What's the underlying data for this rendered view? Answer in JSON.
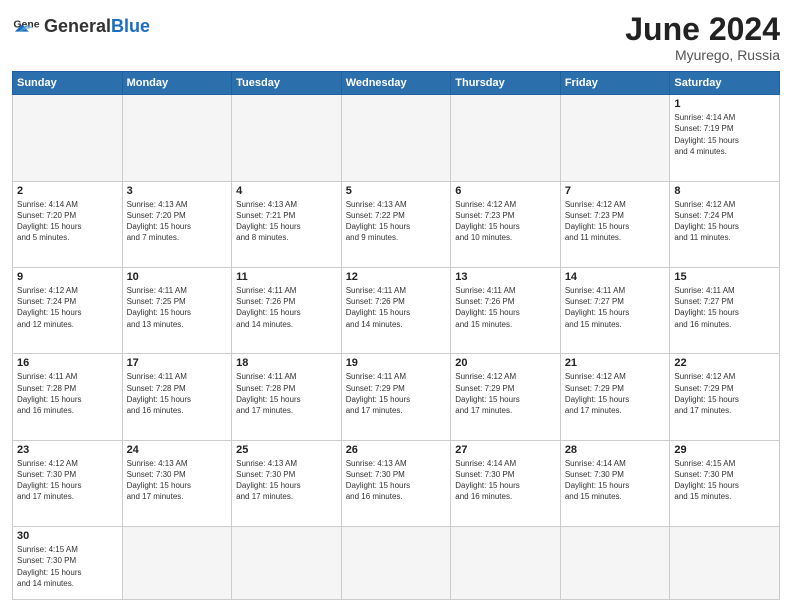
{
  "header": {
    "logo_general": "General",
    "logo_blue": "Blue",
    "month_year": "June 2024",
    "location": "Myurego, Russia"
  },
  "weekdays": [
    "Sunday",
    "Monday",
    "Tuesday",
    "Wednesday",
    "Thursday",
    "Friday",
    "Saturday"
  ],
  "days": [
    {
      "num": "",
      "info": "",
      "empty": true
    },
    {
      "num": "",
      "info": "",
      "empty": true
    },
    {
      "num": "",
      "info": "",
      "empty": true
    },
    {
      "num": "",
      "info": "",
      "empty": true
    },
    {
      "num": "",
      "info": "",
      "empty": true
    },
    {
      "num": "",
      "info": "",
      "empty": true
    },
    {
      "num": "1",
      "info": "Sunrise: 4:14 AM\nSunset: 7:19 PM\nDaylight: 15 hours\nand 4 minutes."
    },
    {
      "num": "2",
      "info": "Sunrise: 4:14 AM\nSunset: 7:20 PM\nDaylight: 15 hours\nand 5 minutes."
    },
    {
      "num": "3",
      "info": "Sunrise: 4:13 AM\nSunset: 7:20 PM\nDaylight: 15 hours\nand 7 minutes."
    },
    {
      "num": "4",
      "info": "Sunrise: 4:13 AM\nSunset: 7:21 PM\nDaylight: 15 hours\nand 8 minutes."
    },
    {
      "num": "5",
      "info": "Sunrise: 4:13 AM\nSunset: 7:22 PM\nDaylight: 15 hours\nand 9 minutes."
    },
    {
      "num": "6",
      "info": "Sunrise: 4:12 AM\nSunset: 7:23 PM\nDaylight: 15 hours\nand 10 minutes."
    },
    {
      "num": "7",
      "info": "Sunrise: 4:12 AM\nSunset: 7:23 PM\nDaylight: 15 hours\nand 11 minutes."
    },
    {
      "num": "8",
      "info": "Sunrise: 4:12 AM\nSunset: 7:24 PM\nDaylight: 15 hours\nand 11 minutes."
    },
    {
      "num": "9",
      "info": "Sunrise: 4:12 AM\nSunset: 7:24 PM\nDaylight: 15 hours\nand 12 minutes."
    },
    {
      "num": "10",
      "info": "Sunrise: 4:11 AM\nSunset: 7:25 PM\nDaylight: 15 hours\nand 13 minutes."
    },
    {
      "num": "11",
      "info": "Sunrise: 4:11 AM\nSunset: 7:26 PM\nDaylight: 15 hours\nand 14 minutes."
    },
    {
      "num": "12",
      "info": "Sunrise: 4:11 AM\nSunset: 7:26 PM\nDaylight: 15 hours\nand 14 minutes."
    },
    {
      "num": "13",
      "info": "Sunrise: 4:11 AM\nSunset: 7:26 PM\nDaylight: 15 hours\nand 15 minutes."
    },
    {
      "num": "14",
      "info": "Sunrise: 4:11 AM\nSunset: 7:27 PM\nDaylight: 15 hours\nand 15 minutes."
    },
    {
      "num": "15",
      "info": "Sunrise: 4:11 AM\nSunset: 7:27 PM\nDaylight: 15 hours\nand 16 minutes."
    },
    {
      "num": "16",
      "info": "Sunrise: 4:11 AM\nSunset: 7:28 PM\nDaylight: 15 hours\nand 16 minutes."
    },
    {
      "num": "17",
      "info": "Sunrise: 4:11 AM\nSunset: 7:28 PM\nDaylight: 15 hours\nand 16 minutes."
    },
    {
      "num": "18",
      "info": "Sunrise: 4:11 AM\nSunset: 7:28 PM\nDaylight: 15 hours\nand 17 minutes."
    },
    {
      "num": "19",
      "info": "Sunrise: 4:11 AM\nSunset: 7:29 PM\nDaylight: 15 hours\nand 17 minutes."
    },
    {
      "num": "20",
      "info": "Sunrise: 4:12 AM\nSunset: 7:29 PM\nDaylight: 15 hours\nand 17 minutes."
    },
    {
      "num": "21",
      "info": "Sunrise: 4:12 AM\nSunset: 7:29 PM\nDaylight: 15 hours\nand 17 minutes."
    },
    {
      "num": "22",
      "info": "Sunrise: 4:12 AM\nSunset: 7:29 PM\nDaylight: 15 hours\nand 17 minutes."
    },
    {
      "num": "23",
      "info": "Sunrise: 4:12 AM\nSunset: 7:30 PM\nDaylight: 15 hours\nand 17 minutes."
    },
    {
      "num": "24",
      "info": "Sunrise: 4:13 AM\nSunset: 7:30 PM\nDaylight: 15 hours\nand 17 minutes."
    },
    {
      "num": "25",
      "info": "Sunrise: 4:13 AM\nSunset: 7:30 PM\nDaylight: 15 hours\nand 17 minutes."
    },
    {
      "num": "26",
      "info": "Sunrise: 4:13 AM\nSunset: 7:30 PM\nDaylight: 15 hours\nand 16 minutes."
    },
    {
      "num": "27",
      "info": "Sunrise: 4:14 AM\nSunset: 7:30 PM\nDaylight: 15 hours\nand 16 minutes."
    },
    {
      "num": "28",
      "info": "Sunrise: 4:14 AM\nSunset: 7:30 PM\nDaylight: 15 hours\nand 15 minutes."
    },
    {
      "num": "29",
      "info": "Sunrise: 4:15 AM\nSunset: 7:30 PM\nDaylight: 15 hours\nand 15 minutes."
    },
    {
      "num": "30",
      "info": "Sunrise: 4:15 AM\nSunset: 7:30 PM\nDaylight: 15 hours\nand 14 minutes."
    },
    {
      "num": "",
      "info": "",
      "empty": true
    },
    {
      "num": "",
      "info": "",
      "empty": true
    },
    {
      "num": "",
      "info": "",
      "empty": true
    },
    {
      "num": "",
      "info": "",
      "empty": true
    },
    {
      "num": "",
      "info": "",
      "empty": true
    },
    {
      "num": "",
      "info": "",
      "empty": true
    }
  ]
}
